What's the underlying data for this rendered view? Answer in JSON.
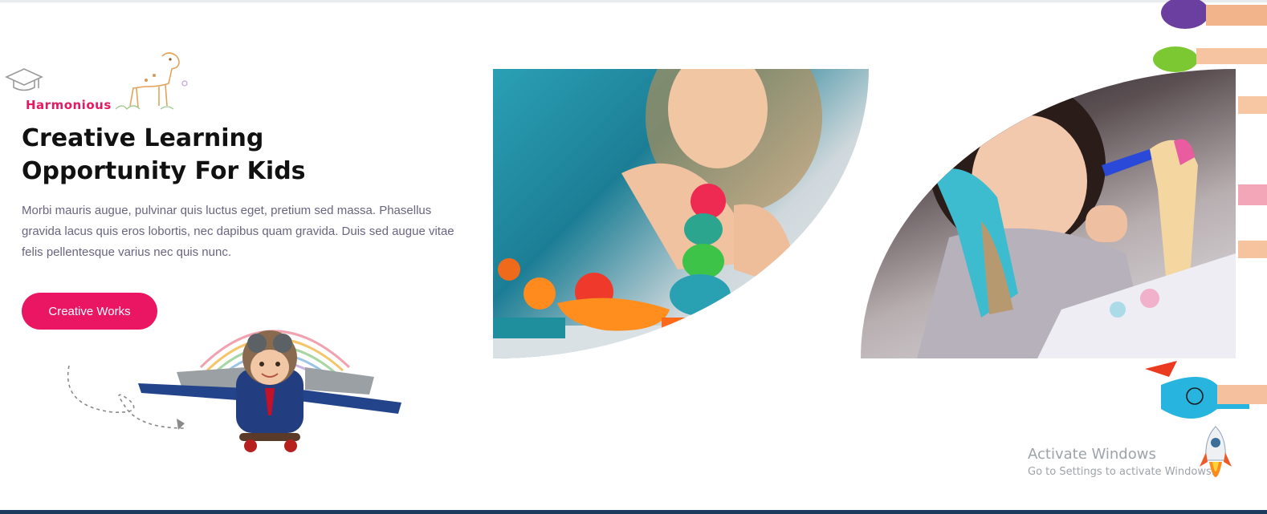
{
  "hero": {
    "tagline": "Harmonious",
    "title": "Creative Learning Opportunity For Kids",
    "description": "Morbi mauris augue, pulvinar quis luctus eget, pretium sed massa. Phasellus gravida lacus quis eros lobortis, nec dapibus quam gravida. Duis sed augue vitae felis pellentesque varius nec quis nunc.",
    "cta_label": "Creative Works"
  },
  "watermark": {
    "title": "Activate Windows",
    "subtitle": "Go to Settings to activate Windows."
  },
  "colors": {
    "accent": "#ea1563",
    "tagline": "#e5195f",
    "heading": "#111111",
    "body_text": "#6b6480"
  },
  "icons": {
    "graduation_cap": "graduation-cap-icon",
    "giraffe_doodle": "giraffe-doodle-icon",
    "rocket": "rocket-icon"
  }
}
